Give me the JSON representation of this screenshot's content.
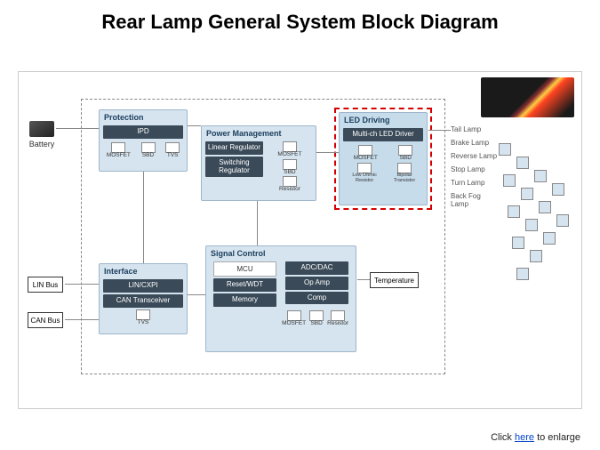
{
  "title": "Rear Lamp General System Block Diagram",
  "external": {
    "battery": "Battery",
    "lin": "LIN Bus",
    "can": "CAN Bus",
    "temperature": "Temperature"
  },
  "lampImageAlt": "Rear lamp photo",
  "blocks": {
    "protection": {
      "title": "Protection",
      "items": [
        "IPD"
      ],
      "symbols": [
        "MOSFET",
        "SBD",
        "TVS"
      ]
    },
    "power": {
      "title": "Power Management",
      "items": [
        "Linear Regulator",
        "Switching Regulator"
      ],
      "symbols": [
        "MOSFET",
        "SBD",
        "Resistor"
      ]
    },
    "led": {
      "title": "LED Driving",
      "items": [
        "Multi-ch LED Driver"
      ],
      "symbols": [
        "MOSFET",
        "SBD",
        "Low Ohmic Resistor",
        "Bipolar Transistor"
      ]
    },
    "interface": {
      "title": "Interface",
      "items": [
        "LIN/CXPI",
        "CAN Transceiver"
      ],
      "symbols": [
        "TVS"
      ]
    },
    "signal": {
      "title": "Signal Control",
      "left": [
        "MCU",
        "Reset/WDT",
        "Memory"
      ],
      "right": [
        "ADC/DAC",
        "Op Amp",
        "Comp"
      ],
      "symbols": [
        "MOSFET",
        "SBD",
        "Resistor"
      ]
    }
  },
  "lamps": [
    "Tail Lamp",
    "Brake Lamp",
    "Reverse Lamp",
    "Stop Lamp",
    "Turn Lamp",
    "Back Fog Lamp"
  ],
  "footer": {
    "prefix": "Click ",
    "link": "here",
    "suffix": " to enlarge"
  }
}
